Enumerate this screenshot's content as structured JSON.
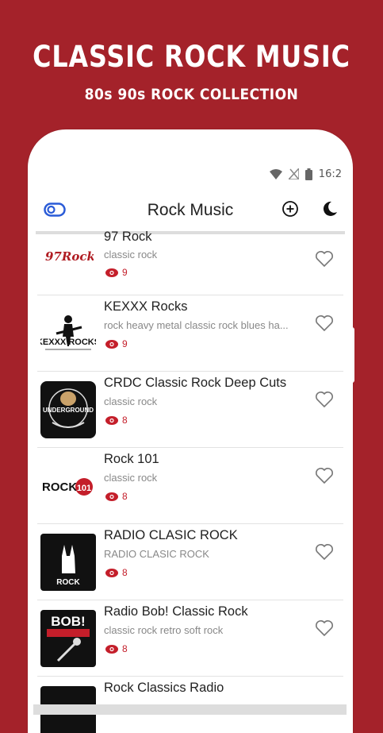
{
  "promo": {
    "title": "CLASSIC ROCK MUSIC",
    "subtitle": "80s 90s ROCK COLLECTION"
  },
  "status_bar": {
    "time": "16:2"
  },
  "app_bar": {
    "title": "Rock Music"
  },
  "stations": [
    {
      "name": "97 Rock",
      "desc": "classic rock",
      "views": "9",
      "logo_text": "97Rock"
    },
    {
      "name": "KEXXX Rocks",
      "desc": "rock heavy metal classic rock blues ha...",
      "views": "9",
      "logo_text": "KEXXX ROCKS"
    },
    {
      "name": "CRDC Classic Rock Deep Cuts",
      "desc": "classic rock",
      "views": "8",
      "logo_text": "UNDERGROUND"
    },
    {
      "name": "Rock 101",
      "desc": "classic rock",
      "views": "8",
      "logo_text": "ROCK101"
    },
    {
      "name": "RADIO CLASIC ROCK",
      "desc": "RADIO CLASIC ROCK",
      "views": "8",
      "logo_text": "ROCK"
    },
    {
      "name": "Radio Bob! Classic Rock",
      "desc": "classic rock retro soft rock",
      "views": "8",
      "logo_text": "BOB!"
    },
    {
      "name": "Rock Classics Radio",
      "desc": "",
      "views": "",
      "logo_text": ""
    }
  ],
  "colors": {
    "brand": "#a4222a",
    "accent": "#c41e2a",
    "toggle": "#2a5bd7"
  }
}
